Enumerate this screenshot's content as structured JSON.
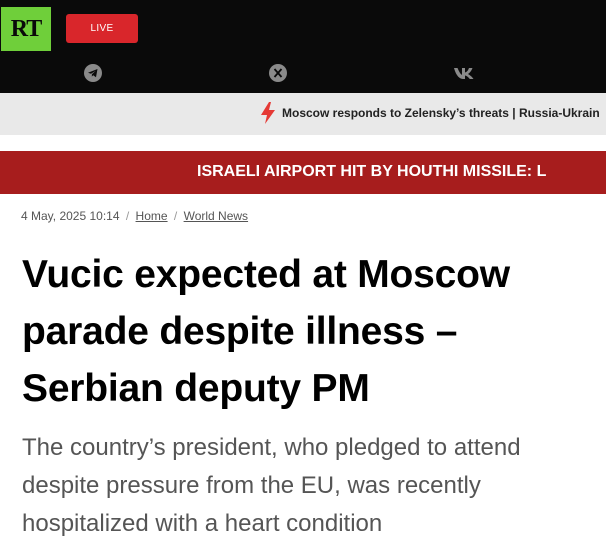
{
  "header": {
    "logo_text": "RT",
    "live_label": "LIVE",
    "social": [
      {
        "name": "telegram-icon"
      },
      {
        "name": "x-icon"
      },
      {
        "name": "vk-icon"
      }
    ],
    "colors": {
      "logo_bg": "#6fcf3a",
      "live_bg": "#d9262b",
      "bar_bg": "#0a0a0a"
    }
  },
  "ticker": {
    "text": "Moscow responds to Zelensky’s threats | Russia-Ukrain"
  },
  "breaking": {
    "text": "ISRAELI AIRPORT HIT BY HOUTHI MISSILE: L",
    "color": "#a71d1d"
  },
  "article": {
    "date": "4 May, 2025 10:14",
    "breadcrumbs": [
      "Home",
      "World News"
    ],
    "headline": [
      "Vucic expected at Moscow",
      "parade despite illness –",
      "Serbian deputy PM"
    ],
    "summary": [
      "The country’s president, who pledged to attend",
      "despite pressure from the EU, was recently",
      "hospitalized with a heart condition"
    ]
  }
}
